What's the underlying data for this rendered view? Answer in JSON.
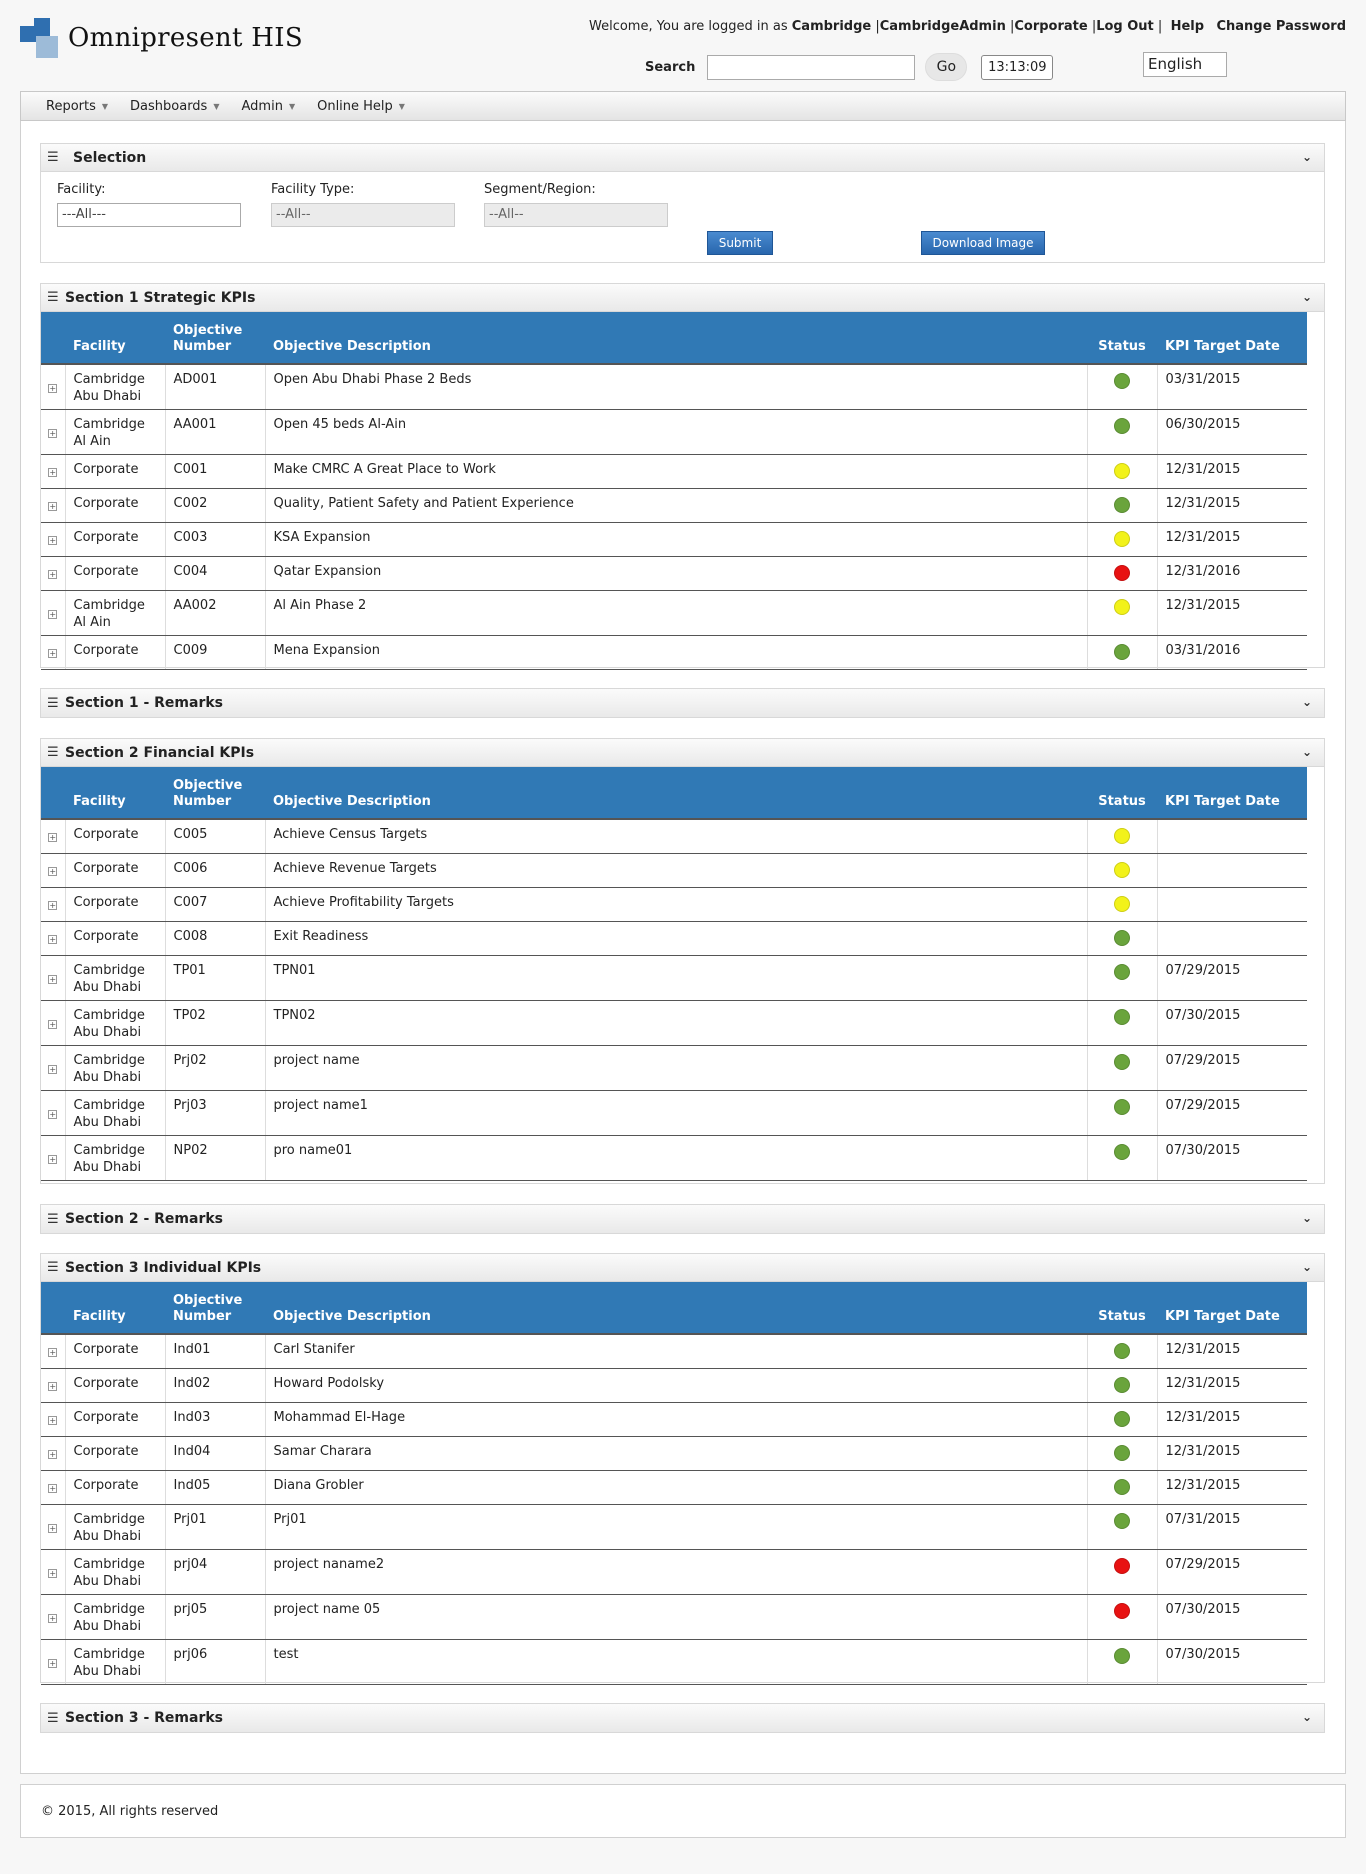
{
  "app": {
    "name": "Omnipresent HIS"
  },
  "topnav": {
    "welcome": "Welcome, You are logged in as",
    "user_facility": "Cambridge",
    "user_name": "CambridgeAdmin",
    "user_role": "Corporate",
    "logout": "Log Out",
    "help": "Help",
    "change_password": "Change Password"
  },
  "search": {
    "label": "Search",
    "value": "",
    "go": "Go"
  },
  "clock": "13:13:09",
  "language": "English",
  "menu": [
    "Reports",
    "Dashboards",
    "Admin",
    "Online Help"
  ],
  "selection": {
    "title": "Selection",
    "facility_label": "Facility:",
    "facility_value": "---All---",
    "type_label": "Facility Type:",
    "type_value": "--All--",
    "region_label": "Segment/Region:",
    "region_value": "--All--",
    "submit": "Submit",
    "download": "Download Image"
  },
  "columns": [
    "Facility",
    "Objective Number",
    "Objective Description",
    "Status",
    "KPI Target Date"
  ],
  "status_colors": {
    "green": "#6aa43c",
    "yellow": "#f2f21a",
    "red": "#e81212"
  },
  "section1": {
    "title": "Section 1 Strategic KPIs",
    "rows": [
      {
        "facility": "Cambridge Abu Dhabi",
        "number": "AD001",
        "desc": "Open Abu Dhabi Phase 2 Beds",
        "status": "green",
        "date": "03/31/2015"
      },
      {
        "facility": "Cambridge Al Ain",
        "number": "AA001",
        "desc": "Open 45 beds Al-Ain",
        "status": "green",
        "date": "06/30/2015"
      },
      {
        "facility": "Corporate",
        "number": "C001",
        "desc": "Make CMRC A Great Place to Work",
        "status": "yellow",
        "date": "12/31/2015"
      },
      {
        "facility": "Corporate",
        "number": "C002",
        "desc": "Quality, Patient Safety and Patient Experience",
        "status": "green",
        "date": "12/31/2015"
      },
      {
        "facility": "Corporate",
        "number": "C003",
        "desc": "KSA Expansion",
        "status": "yellow",
        "date": "12/31/2015"
      },
      {
        "facility": "Corporate",
        "number": "C004",
        "desc": "Qatar Expansion",
        "status": "red",
        "date": "12/31/2016"
      },
      {
        "facility": "Cambridge Al Ain",
        "number": "AA002",
        "desc": "Al Ain Phase 2",
        "status": "yellow",
        "date": "12/31/2015"
      },
      {
        "facility": "Corporate",
        "number": "C009",
        "desc": "Mena Expansion",
        "status": "green",
        "date": "03/31/2016"
      }
    ]
  },
  "section1_remarks": {
    "title": "Section 1 - Remarks"
  },
  "section2": {
    "title": "Section 2 Financial KPIs",
    "rows": [
      {
        "facility": "Corporate",
        "number": "C005",
        "desc": "Achieve Census Targets",
        "status": "yellow",
        "date": ""
      },
      {
        "facility": "Corporate",
        "number": "C006",
        "desc": "Achieve Revenue Targets",
        "status": "yellow",
        "date": ""
      },
      {
        "facility": "Corporate",
        "number": "C007",
        "desc": "Achieve Profitability Targets",
        "status": "yellow",
        "date": ""
      },
      {
        "facility": "Corporate",
        "number": "C008",
        "desc": "Exit Readiness",
        "status": "green",
        "date": ""
      },
      {
        "facility": "Cambridge Abu Dhabi",
        "number": "TP01",
        "desc": "TPN01",
        "status": "green",
        "date": "07/29/2015"
      },
      {
        "facility": "Cambridge Abu Dhabi",
        "number": "TP02",
        "desc": "TPN02",
        "status": "green",
        "date": "07/30/2015"
      },
      {
        "facility": "Cambridge Abu Dhabi",
        "number": "Prj02",
        "desc": "project name",
        "status": "green",
        "date": "07/29/2015"
      },
      {
        "facility": "Cambridge Abu Dhabi",
        "number": "Prj03",
        "desc": "project name1",
        "status": "green",
        "date": "07/29/2015"
      },
      {
        "facility": "Cambridge Abu Dhabi",
        "number": "NP02",
        "desc": "pro name01",
        "status": "green",
        "date": "07/30/2015"
      }
    ]
  },
  "section2_remarks": {
    "title": "Section 2 - Remarks"
  },
  "section3": {
    "title": "Section 3 Individual KPIs",
    "rows": [
      {
        "facility": "Corporate",
        "number": "Ind01",
        "desc": "Carl Stanifer",
        "status": "green",
        "date": "12/31/2015"
      },
      {
        "facility": "Corporate",
        "number": "Ind02",
        "desc": "Howard Podolsky",
        "status": "green",
        "date": "12/31/2015"
      },
      {
        "facility": "Corporate",
        "number": "Ind03",
        "desc": "Mohammad El-Hage",
        "status": "green",
        "date": "12/31/2015"
      },
      {
        "facility": "Corporate",
        "number": "Ind04",
        "desc": "Samar Charara",
        "status": "green",
        "date": "12/31/2015"
      },
      {
        "facility": "Corporate",
        "number": "Ind05",
        "desc": "Diana Grobler",
        "status": "green",
        "date": "12/31/2015"
      },
      {
        "facility": "Cambridge Abu Dhabi",
        "number": "Prj01",
        "desc": "Prj01",
        "status": "green",
        "date": "07/31/2015"
      },
      {
        "facility": "Cambridge Abu Dhabi",
        "number": "prj04",
        "desc": "project naname2",
        "status": "red",
        "date": "07/29/2015"
      },
      {
        "facility": "Cambridge Abu Dhabi",
        "number": "prj05",
        "desc": "project name 05",
        "status": "red",
        "date": "07/30/2015"
      },
      {
        "facility": "Cambridge Abu Dhabi",
        "number": "prj06",
        "desc": "test",
        "status": "green",
        "date": "07/30/2015"
      }
    ]
  },
  "section3_remarks": {
    "title": "Section 3 - Remarks"
  },
  "footer": "© 2015, All rights reserved"
}
